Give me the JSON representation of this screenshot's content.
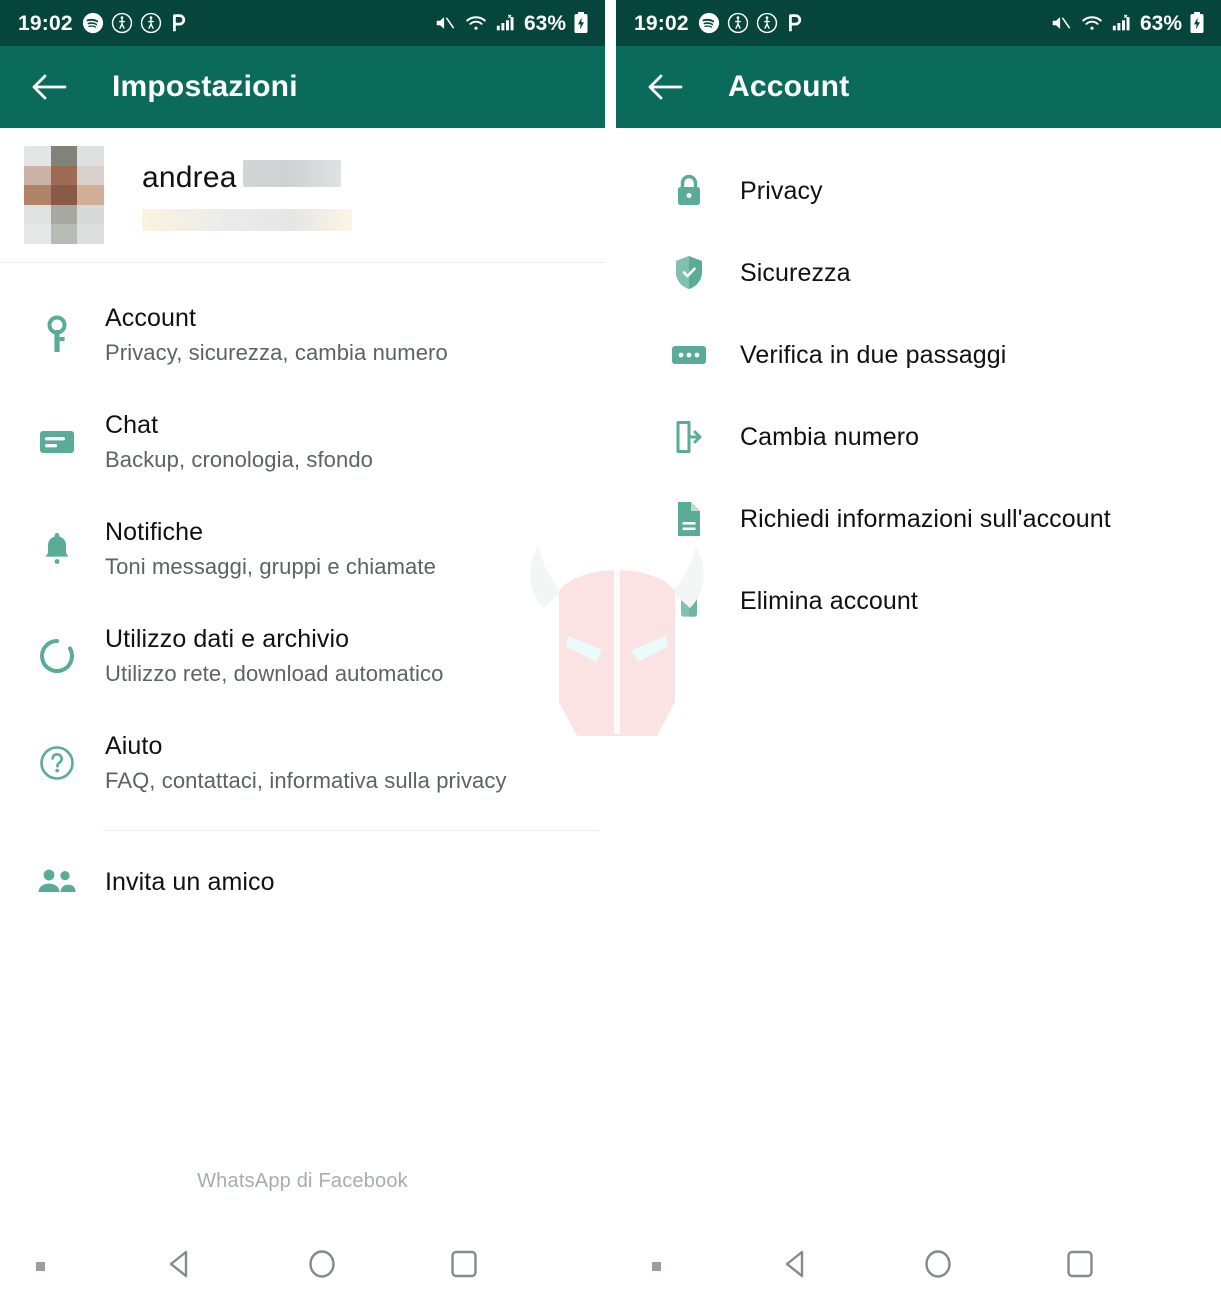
{
  "status_bar": {
    "time": "19:02",
    "battery_percent": "63%",
    "left_icons": [
      "spotify-icon",
      "pedometer-icon",
      "pedometer-icon",
      "parking-p-icon"
    ],
    "right_icons": [
      "mute-icon",
      "wifi-icon",
      "cellular-signal-icon",
      "battery-icon"
    ],
    "background_color": "#06453b"
  },
  "theme": {
    "appbar_color": "#0b6b5b",
    "icon_teal": "#5aab97",
    "title_color": "#ffffff",
    "body_text": "#111111",
    "subtitle_text": "#5d6265"
  },
  "left_screen": {
    "appbar": {
      "back_icon": "arrow-back-icon",
      "title": "Impostazioni"
    },
    "profile": {
      "name": "andrea",
      "name_redacted": true,
      "status_redacted": true,
      "avatar": "redacted-avatar"
    },
    "items": [
      {
        "icon": "key-icon",
        "title": "Account",
        "subtitle": "Privacy, sicurezza, cambia numero"
      },
      {
        "icon": "chat-icon",
        "title": "Chat",
        "subtitle": "Backup, cronologia, sfondo"
      },
      {
        "icon": "bell-icon",
        "title": "Notifiche",
        "subtitle": "Toni messaggi, gruppi e chiamate"
      },
      {
        "icon": "data-usage-icon",
        "title": "Utilizzo dati e archivio",
        "subtitle": "Utilizzo rete, download automatico"
      },
      {
        "icon": "help-icon",
        "title": "Aiuto",
        "subtitle": "FAQ, contattaci, informativa sulla privacy"
      }
    ],
    "invite": {
      "icon": "people-icon",
      "title": "Invita un amico"
    },
    "footer": "WhatsApp di Facebook"
  },
  "right_screen": {
    "appbar": {
      "back_icon": "arrow-back-icon",
      "title": "Account"
    },
    "items": [
      {
        "icon": "lock-icon",
        "title": "Privacy"
      },
      {
        "icon": "shield-icon",
        "title": "Sicurezza"
      },
      {
        "icon": "pin-dots-icon",
        "title": "Verifica in due passaggi"
      },
      {
        "icon": "change-number-icon",
        "title": "Cambia numero"
      },
      {
        "icon": "document-icon",
        "title": "Richiedi informazioni sull'account"
      },
      {
        "icon": "trash-icon",
        "title": "Elimina account"
      }
    ]
  },
  "nav_bar": {
    "dot": "nav-indicator-dot",
    "buttons": [
      "back-nav-icon",
      "home-nav-icon",
      "recents-nav-icon"
    ]
  },
  "watermark": {
    "label": "viking-helmet-watermark",
    "color": "#fbe4e4"
  }
}
